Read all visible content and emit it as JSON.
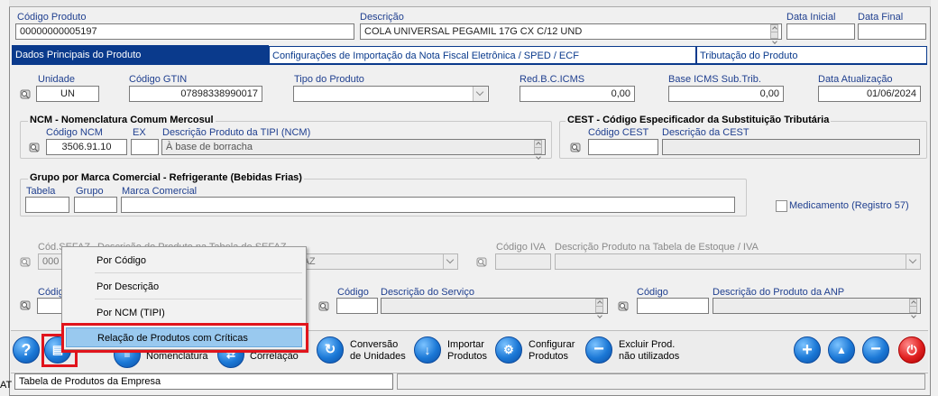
{
  "header": {
    "codigo_label": "Código Produto",
    "codigo_value": "00000000005197",
    "descricao_label": "Descrição",
    "descricao_value": "COLA UNIVERSAL PEGAMIL 17G CX C/12 UND",
    "data_inicial_label": "Data Inicial",
    "data_final_label": "Data Final"
  },
  "tabs": [
    {
      "label": "Dados Principais do Produto"
    },
    {
      "label": "Configurações de Importação da Nota Fiscal Eletrônica / SPED / ECF"
    },
    {
      "label": "Tributação do Produto"
    }
  ],
  "row1": {
    "unidade_label": "Unidade",
    "unidade_value": "UN",
    "gtin_label": "Código GTIN",
    "gtin_value": "07898338990017",
    "tipo_label": "Tipo do Produto",
    "red_label": "Red.B.C.ICMS",
    "red_value": "0,00",
    "base_label": "Base ICMS Sub.Trib.",
    "base_value": "0,00",
    "data_atual_label": "Data Atualização",
    "data_atual_value": "01/06/2024"
  },
  "ncm": {
    "title": "NCM - Nomenclatura Comum Mercosul",
    "codigo_label": "Código NCM",
    "codigo_value": "3506.91.10",
    "ex_label": "EX",
    "desc_label": "Descrição Produto da TIPI (NCM)",
    "desc_value": "À base de borracha"
  },
  "cest": {
    "title": "CEST - Código Especificador da Substituição Tributária",
    "codigo_label": "Código CEST",
    "desc_label": "Descrição da CEST"
  },
  "grupo": {
    "title": "Grupo por Marca Comercial - Refrigerante (Bebidas Frias)",
    "tabela_label": "Tabela",
    "grupo_label": "Grupo",
    "marca_label": "Marca Comercial"
  },
  "medicamento_label": "Medicamento  (Registro  57)",
  "sefaz": {
    "cod_label": "Cód.SEFAZ",
    "cod_value": "000",
    "desc_label": "Descrição do Produto na Tabela de SEFAZ",
    "desc_value": "A SEFAZ"
  },
  "iva": {
    "cod_label": "Código IVA",
    "desc_label": "Descrição Produto na Tabela de Estoque / IVA"
  },
  "row5": {
    "codigo_label_a": "Código",
    "servico_cod_label": "Código",
    "servico_desc_label": "Descrição do Serviço",
    "anp_cod_label": "Código",
    "anp_desc_label": "Descrição do Produto da ANP"
  },
  "context_menu": [
    {
      "label": "Por Código"
    },
    {
      "label": "Por Descrição"
    },
    {
      "label": "Por NCM (TIPI)"
    },
    {
      "label": "Relação de Produtos com Críticas"
    }
  ],
  "toolbar": {
    "nomenclatura": "Nomenclatura",
    "correlacao": "Correlação",
    "conversao_1": "Conversão",
    "conversao_2": "de Unidades",
    "importar_1": "Importar",
    "importar_2": "Produtos",
    "configurar_1": "Configurar",
    "configurar_2": "Produtos",
    "excluir_1": "Excluir Prod.",
    "excluir_2": "não utilizados"
  },
  "status_bar": "Tabela de Produtos da Empresa",
  "side_label": "AT",
  "colors": {
    "tab_blue": "#0a3a8c",
    "highlight": "#99c9ef",
    "red_box": "#e1141c"
  }
}
